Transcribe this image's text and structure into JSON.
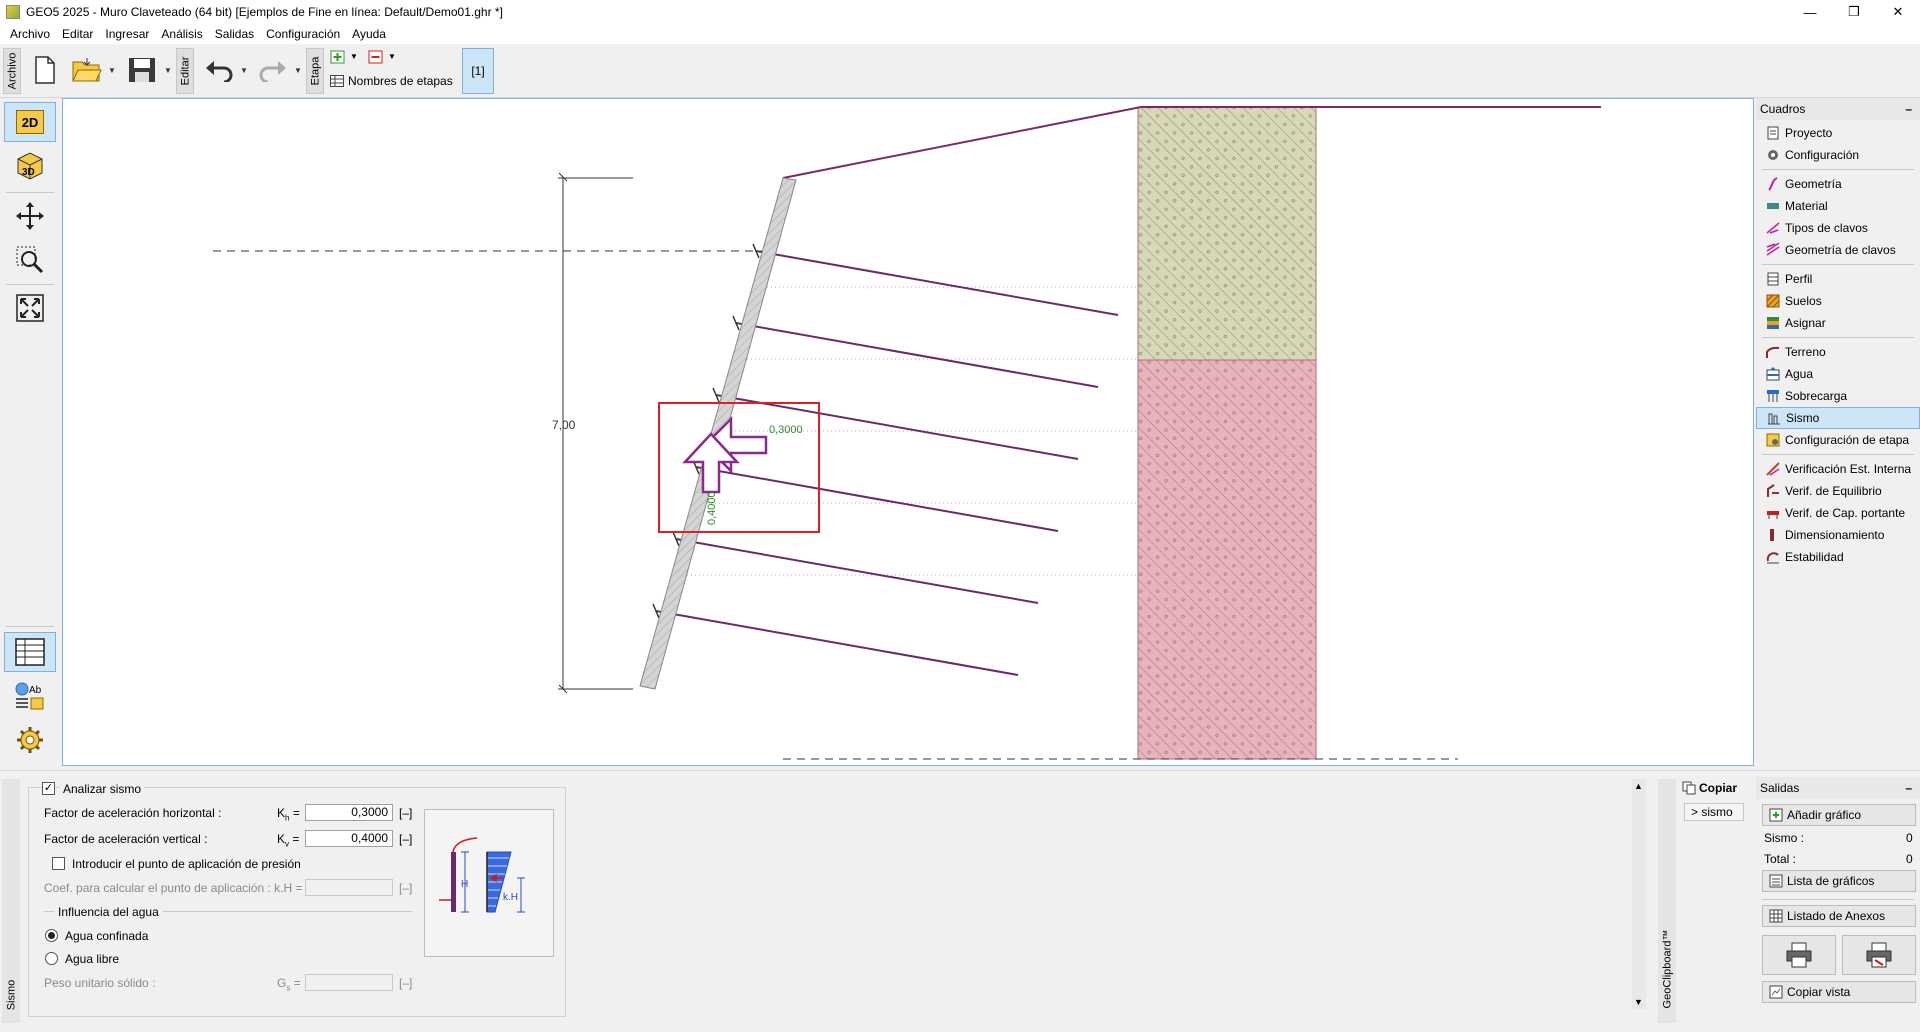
{
  "window": {
    "title": "GEO5 2025 - Muro Claveteado (64 bit) [Ejemplos de Fine en línea: Default/Demo01.ghr *]"
  },
  "menu": [
    "Archivo",
    "Editar",
    "Ingresar",
    "Análisis",
    "Salidas",
    "Configuración",
    "Ayuda"
  ],
  "toolbar": {
    "vtab_archivo": "Archivo",
    "vtab_editar": "Editar",
    "vtab_etapa": "Etapa",
    "stage_names_label": "Nombres de etapas",
    "stage_button": "[1]"
  },
  "left_toolbar": {
    "btn_2d": "2D",
    "btn_3d": "3D",
    "btn_ab": "Ab"
  },
  "drawing": {
    "height_dim": "7,00",
    "kh_label": "0,3000",
    "kv_label": "0,4000"
  },
  "right_panel": {
    "header": "Cuadros",
    "collapse": "–",
    "groups": [
      [
        "Proyecto",
        "Configuración"
      ],
      [
        "Geometría",
        "Material",
        "Tipos de clavos",
        "Geometría de clavos"
      ],
      [
        "Perfil",
        "Suelos",
        "Asignar"
      ],
      [
        "Terreno",
        "Agua",
        "Sobrecarga",
        "Sismo",
        "Configuración de etapa"
      ],
      [
        "Verificación Est. Interna",
        "Verif. de Equilibrio",
        "Verif. de Cap. portante",
        "Dimensionamiento",
        "Estabilidad"
      ]
    ],
    "active_item": "Sismo"
  },
  "bottom": {
    "side_label": "Sismo",
    "analyze_label": "Analizar sismo",
    "kh_label": "Factor de aceleración horizontal :",
    "kh_symbol": "K",
    "kh_sub": "h",
    "kh_value": "0,3000",
    "kv_label": "Factor de aceleración vertical :",
    "kv_symbol": "K",
    "kv_sub": "v",
    "kv_value": "0,4000",
    "unit": "[–]",
    "eq": "=",
    "point_label": "Introducir el punto de aplicación de presión",
    "coef_label": "Coef. para calcular el punto de aplicación : k.H =",
    "water_header": "Influencia del agua",
    "water_confined": "Agua confinada",
    "water_free": "Agua libre",
    "unit_weight_label": "Peso unitario sólido :",
    "gs_symbol": "G",
    "gs_sub": "s",
    "diagram_h": "H",
    "diagram_kh": "k.H"
  },
  "clipboard": {
    "copy_label": "Copiar",
    "item": "> sismo",
    "side_label": "GeoClipboard™"
  },
  "outputs": {
    "header": "Salidas",
    "collapse": "–",
    "add_graphic": "Añadir gráfico",
    "sismo_label": "Sismo :",
    "sismo_count": "0",
    "total_label": "Total :",
    "total_count": "0",
    "graphics_list": "Lista de gráficos",
    "annex_list": "Listado de Anexos",
    "copy_view": "Copiar vista"
  }
}
